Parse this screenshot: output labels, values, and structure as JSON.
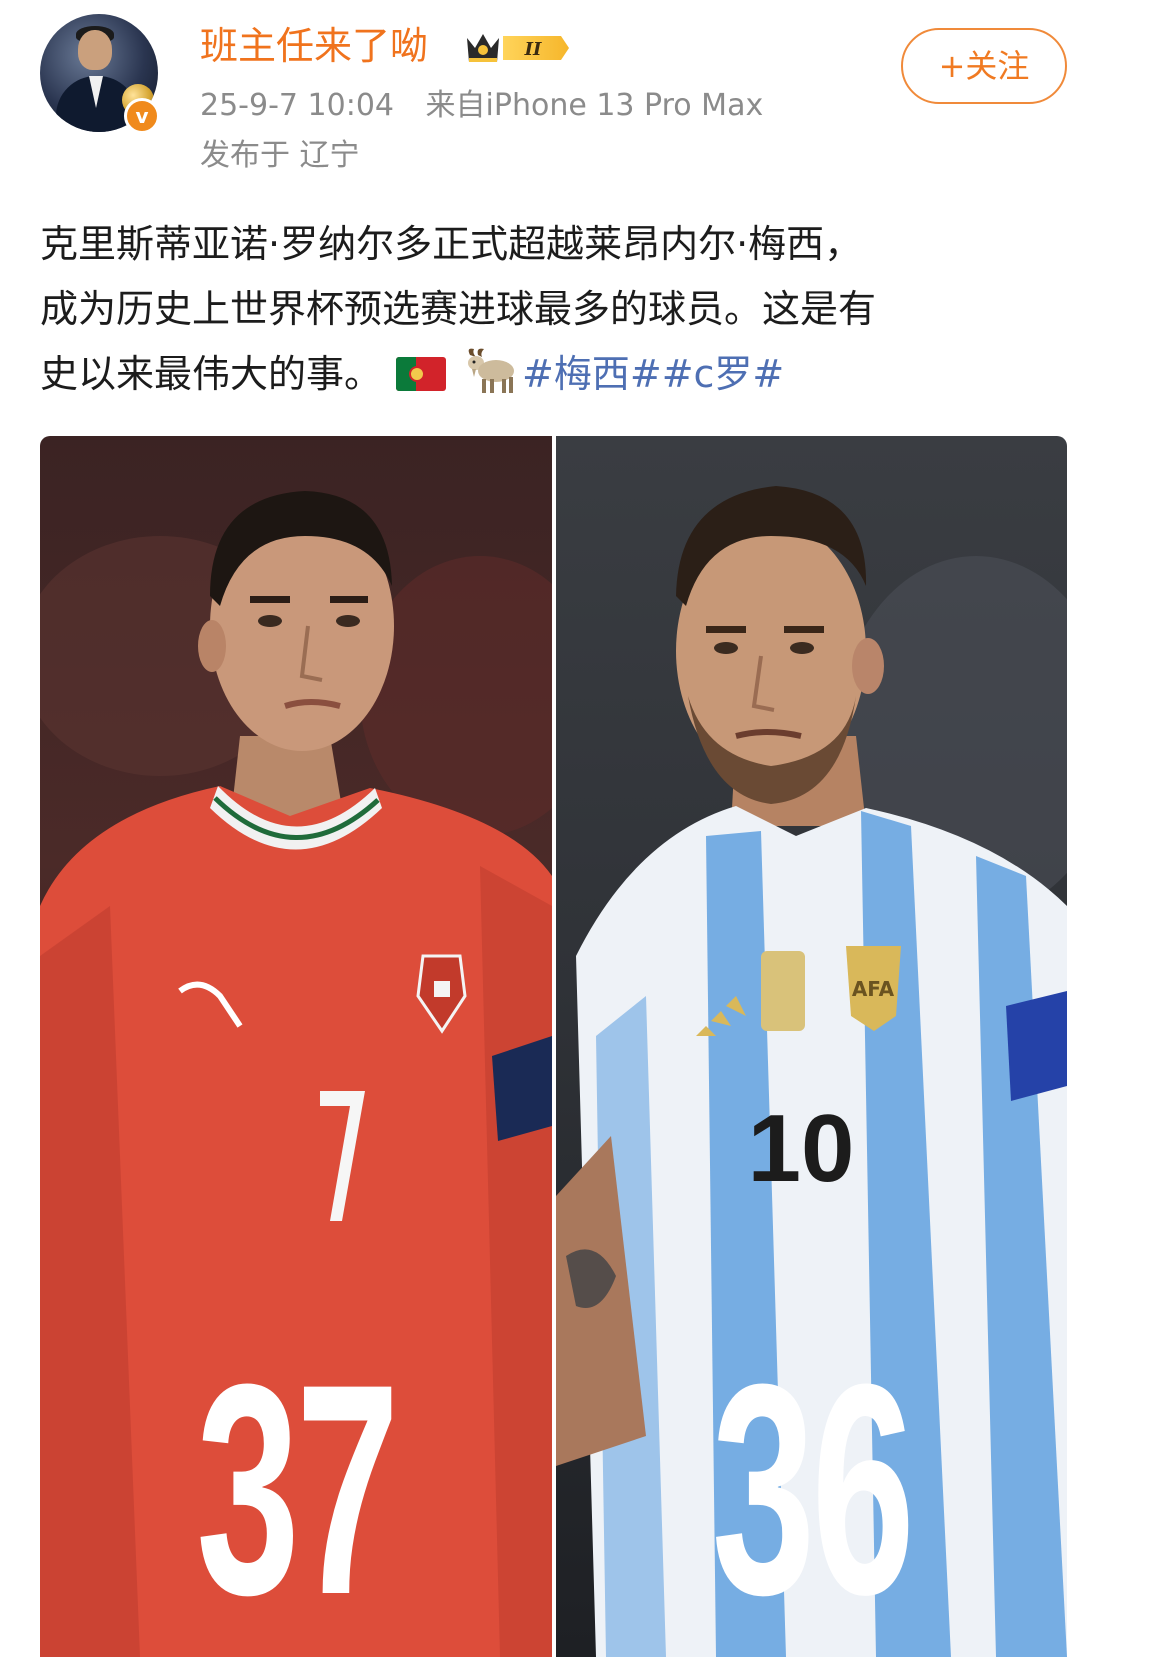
{
  "header": {
    "username": "班主任来了呦",
    "level_badge": "II",
    "timestamp": "25-9-7 10:04",
    "source": "来自iPhone 13 Pro Max",
    "location": "发布于 辽宁",
    "follow_label": "+关注",
    "verify_mark": "v"
  },
  "post": {
    "line1": "克里斯蒂亚诺·罗纳尔多正式超越莱昂内尔·梅西，",
    "line2": "成为历史上世界杯预选赛进球最多的球员。这是有",
    "line3": "史以来最伟大的事。",
    "emojis": [
      "portugal-flag",
      "goat"
    ],
    "hashtags": "#梅西##c罗#"
  },
  "image": {
    "left": {
      "jersey_number": "7",
      "goal_count": "37",
      "jersey_color": "#e2543f"
    },
    "right": {
      "jersey_number": "10",
      "goal_count": "36",
      "jersey_color": "#7fb3e6"
    }
  },
  "colors": {
    "username": "#f0731d",
    "hashtag": "#4e6fb3",
    "meta": "#8b8b8b"
  }
}
